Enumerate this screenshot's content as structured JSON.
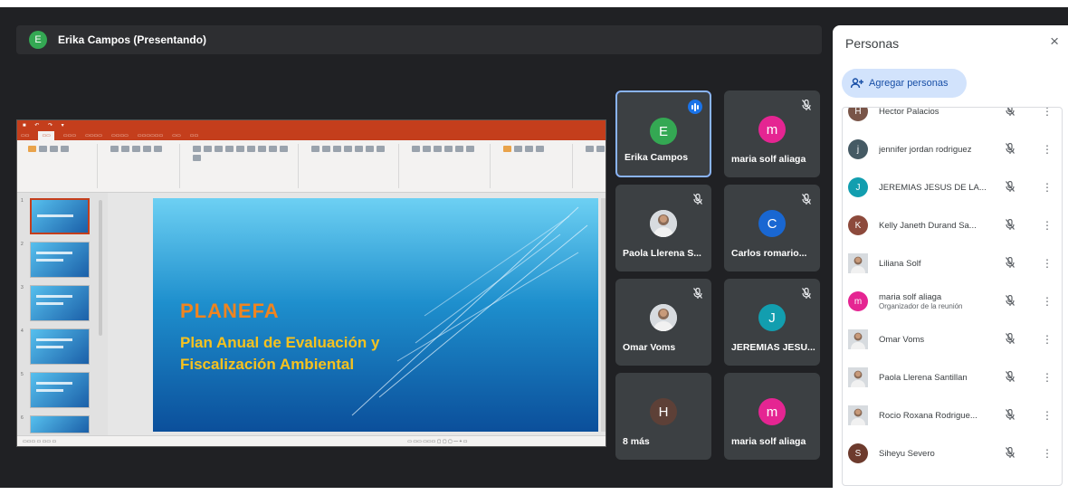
{
  "presenter": {
    "initial": "E",
    "label": "Erika Campos (Presentando)",
    "avatar_color": "#34a853"
  },
  "slide": {
    "title": "PLANEFA",
    "subtitle_line1": "Plan Anual de Evaluación y",
    "subtitle_line2": "Fiscalización Ambiental"
  },
  "tiles": [
    {
      "name": "Erika Campos",
      "initial": "E",
      "color": "#34a853",
      "speaking": true,
      "muted": false,
      "photo": false
    },
    {
      "name": "maria solf aliaga",
      "initial": "m",
      "color": "#e52592",
      "speaking": false,
      "muted": true,
      "photo": false
    },
    {
      "name": "Paola Llerena S...",
      "initial": "",
      "color": "#cfd3d6",
      "speaking": false,
      "muted": true,
      "photo": true
    },
    {
      "name": "Carlos romario...",
      "initial": "C",
      "color": "#1967d2",
      "speaking": false,
      "muted": true,
      "photo": false
    },
    {
      "name": "Omar Voms",
      "initial": "",
      "color": "#cfd3d6",
      "speaking": false,
      "muted": true,
      "photo": true
    },
    {
      "name": "JEREMIAS JESU...",
      "initial": "J",
      "color": "#129eaf",
      "speaking": false,
      "muted": true,
      "photo": false
    },
    {
      "name": "8 más",
      "initial": "H",
      "color": "#5d4037",
      "speaking": false,
      "muted": false,
      "photo": false
    },
    {
      "name": "maria solf aliaga",
      "initial": "m",
      "color": "#e52592",
      "speaking": false,
      "muted": false,
      "photo": false
    }
  ],
  "panel": {
    "title": "Personas",
    "close": "×",
    "add_people": "Agregar personas",
    "people": [
      {
        "name": "Hector Palacios",
        "role": "",
        "initial": "H",
        "color": "#795548",
        "photo": false
      },
      {
        "name": "jennifer jordan rodriguez",
        "role": "",
        "initial": "j",
        "color": "#455a64",
        "photo": false
      },
      {
        "name": "JEREMIAS JESUS DE LA...",
        "role": "",
        "initial": "J",
        "color": "#129eaf",
        "photo": false
      },
      {
        "name": "Kelly Janeth Durand Sa...",
        "role": "",
        "initial": "K",
        "color": "#8d4a3c",
        "photo": false
      },
      {
        "name": "Liliana Solf",
        "role": "",
        "initial": "",
        "color": "#cfd3d6",
        "photo": true
      },
      {
        "name": "maria solf aliaga",
        "role": "Organizador de la reunión",
        "initial": "m",
        "color": "#e52592",
        "photo": false
      },
      {
        "name": "Omar Voms",
        "role": "",
        "initial": "",
        "color": "#cfd3d6",
        "photo": true
      },
      {
        "name": "Paola Llerena Santillan",
        "role": "",
        "initial": "",
        "color": "#cfd3d6",
        "photo": true
      },
      {
        "name": "Rocio Roxana Rodrigue...",
        "role": "",
        "initial": "",
        "color": "#cfd3d6",
        "photo": true
      },
      {
        "name": "Siheyu Severo",
        "role": "",
        "initial": "S",
        "color": "#6d3b2d",
        "photo": false
      }
    ]
  }
}
